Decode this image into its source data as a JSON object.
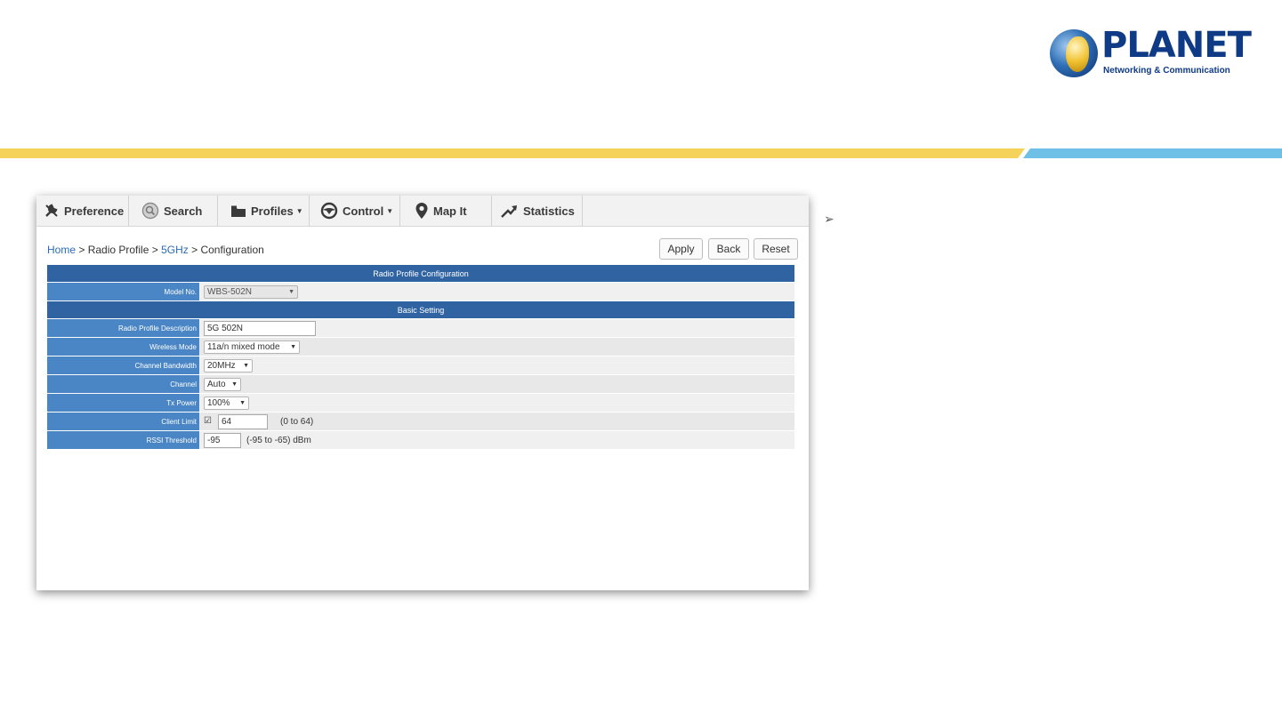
{
  "logo": {
    "name": "PLANET",
    "tagline": "Networking & Communication"
  },
  "colors": {
    "stripe_yellow": "#f5d25a",
    "stripe_blue": "#6ec0e6",
    "table_header": "#2f63a2",
    "label_cell": "#4a86c5",
    "link": "#2a6bb6"
  },
  "nav": {
    "items": [
      {
        "label": "Preference",
        "icon": "wrench-icon"
      },
      {
        "label": "Search",
        "icon": "search-icon"
      },
      {
        "label": "Profiles",
        "icon": "folder-icon",
        "dropdown": true
      },
      {
        "label": "Control",
        "icon": "steering-wheel-icon",
        "dropdown": true
      },
      {
        "label": "Map It",
        "icon": "map-pin-icon"
      },
      {
        "label": "Statistics",
        "icon": "trend-arrow-icon"
      }
    ]
  },
  "breadcrumb": {
    "home": "Home",
    "sep1": " > Radio Profile > ",
    "band": "5GHz",
    "sep2": " > Configuration"
  },
  "buttons": {
    "apply": "Apply",
    "back": "Back",
    "reset": "Reset"
  },
  "section1": {
    "title": "Radio Profile Configuration",
    "model_label": "Model No.",
    "model_value": "WBS-502N"
  },
  "section2": {
    "title": "Basic Setting",
    "description_label": "Radio Profile Description",
    "description_value": "5G 502N",
    "mode_label": "Wireless Mode",
    "mode_value": "11a/n mixed mode",
    "bandwidth_label": "Channel Bandwidth",
    "bandwidth_value": "20MHz",
    "channel_label": "Channel",
    "channel_value": "Auto",
    "txpower_label": "Tx Power",
    "txpower_value": "100%",
    "client_label": "Client Limit",
    "client_checked": true,
    "client_value": "64",
    "client_hint": "(0 to 64)",
    "rssi_label": "RSSI Threshold",
    "rssi_value": "-95",
    "rssi_hint": "(-95 to -65) dBm"
  },
  "side": {
    "bullet": "➢"
  }
}
